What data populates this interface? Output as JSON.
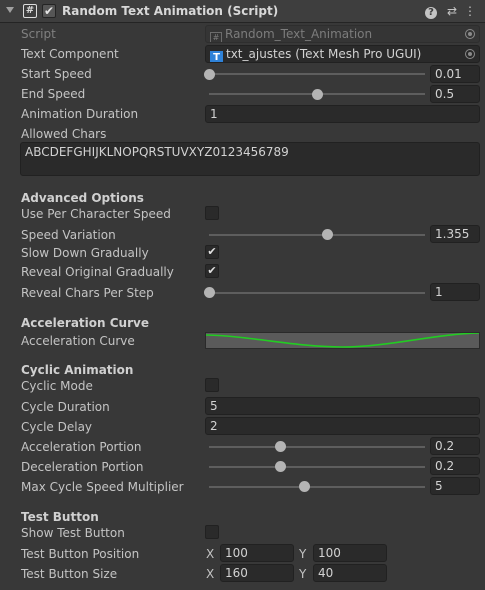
{
  "header": {
    "title": "Random Text Animation (Script)",
    "icons": [
      "fold-triangle-icon",
      "script-icon",
      "enable-checkbox",
      "help-icon",
      "presets-icon",
      "context-menu-icon"
    ]
  },
  "fields": {
    "script": {
      "label": "Script",
      "value": "Random_Text_Animation"
    },
    "text_component": {
      "label": "Text Component",
      "value": "txt_ajustes (Text Mesh Pro UGUI)",
      "icon_letter": "T"
    },
    "start_speed": {
      "label": "Start Speed",
      "value": "0.01",
      "slider_fraction": 0.0
    },
    "end_speed": {
      "label": "End Speed",
      "value": "0.5",
      "slider_fraction": 0.5
    },
    "animation_duration": {
      "label": "Animation Duration",
      "value": "1"
    },
    "allowed_chars": {
      "label": "Allowed Chars",
      "value": "ABCDEFGHIJKLNOPQRSTUVXYZ0123456789"
    }
  },
  "advanced": {
    "title": "Advanced Options",
    "use_per_char_speed": {
      "label": "Use Per Character Speed",
      "checked": false
    },
    "speed_variation": {
      "label": "Speed Variation",
      "value": "1.355",
      "slider_fraction": 0.55
    },
    "slow_down": {
      "label": "Slow Down Gradually",
      "checked": true
    },
    "reveal_original": {
      "label": "Reveal Original Gradually",
      "checked": true
    },
    "reveal_chars": {
      "label": "Reveal Chars Per Step",
      "value": "1",
      "slider_fraction": 0.0
    }
  },
  "acceleration": {
    "title": "Acceleration Curve",
    "curve_label": "Acceleration Curve",
    "curve_color": "#22cc22"
  },
  "cyclic": {
    "title": "Cyclic Animation",
    "cyclic_mode": {
      "label": "Cyclic Mode",
      "checked": false
    },
    "cycle_duration": {
      "label": "Cycle Duration",
      "value": "5"
    },
    "cycle_delay": {
      "label": "Cycle Delay",
      "value": "2"
    },
    "accel_portion": {
      "label": "Acceleration Portion",
      "value": "0.2",
      "slider_fraction": 0.33
    },
    "decel_portion": {
      "label": "Deceleration Portion",
      "value": "0.2",
      "slider_fraction": 0.33
    },
    "max_cycle": {
      "label": "Max Cycle Speed Multiplier",
      "value": "5",
      "slider_fraction": 0.44
    }
  },
  "test": {
    "title": "Test Button",
    "show": {
      "label": "Show Test Button",
      "checked": false
    },
    "position": {
      "label": "Test Button Position",
      "x_label": "X",
      "x": "100",
      "y_label": "Y",
      "y": "100"
    },
    "size": {
      "label": "Test Button Size",
      "x_label": "X",
      "x": "160",
      "y_label": "Y",
      "y": "40"
    }
  },
  "colors": {
    "background": "#383838",
    "field": "#2a2a2a",
    "tmp_icon": "#2f82d8"
  }
}
